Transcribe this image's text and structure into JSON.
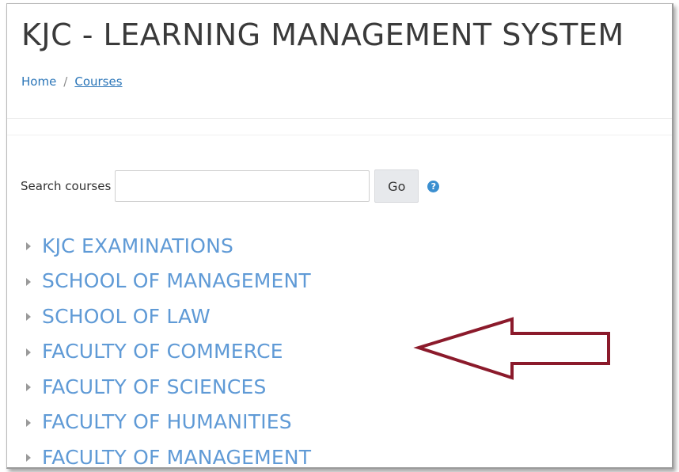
{
  "header": {
    "title": "KJC - LEARNING MANAGEMENT SYSTEM"
  },
  "breadcrumb": {
    "home": "Home",
    "separator": "/",
    "current": "Courses"
  },
  "search": {
    "label": "Search courses",
    "value": "",
    "placeholder": "",
    "go_label": "Go",
    "help_icon": "question-circle-icon"
  },
  "categories": [
    {
      "label": "KJC EXAMINATIONS"
    },
    {
      "label": "SCHOOL OF MANAGEMENT"
    },
    {
      "label": "SCHOOL OF LAW"
    },
    {
      "label": "FACULTY OF COMMERCE"
    },
    {
      "label": "FACULTY OF SCIENCES"
    },
    {
      "label": "FACULTY OF HUMANITIES"
    },
    {
      "label": "FACULTY OF MANAGEMENT"
    }
  ],
  "colors": {
    "link": "#5f9ad6",
    "breadcrumb_link": "#2a75b8",
    "annotation_arrow": "#8b1a2b",
    "help_icon": "#3b8fd0"
  },
  "annotation": {
    "icon": "left-arrow-icon",
    "points_to": "FACULTY OF COMMERCE"
  }
}
